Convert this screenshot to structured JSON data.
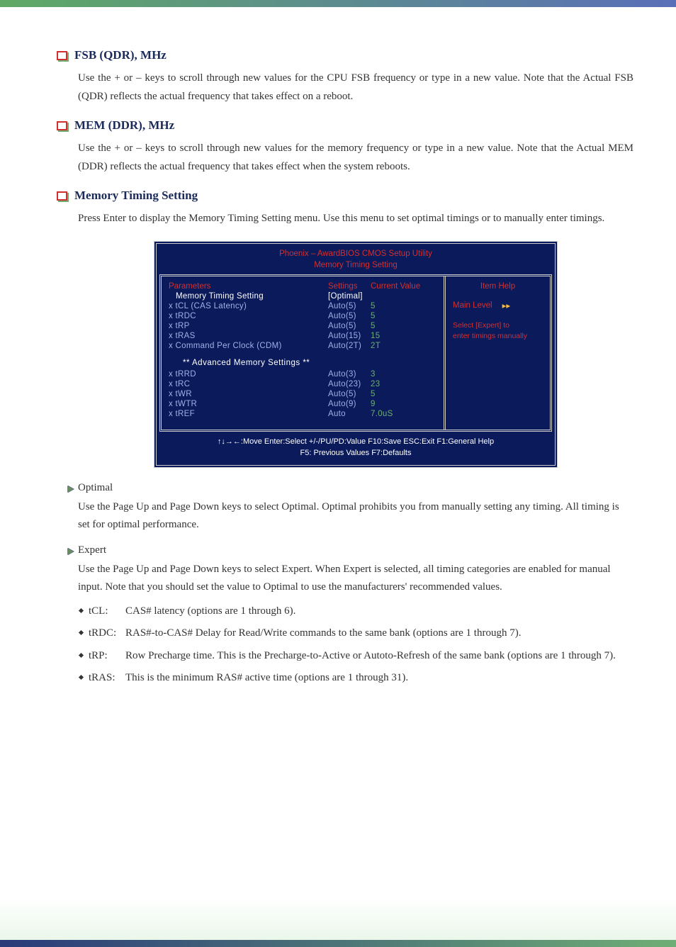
{
  "sections": {
    "fsb": {
      "title": "FSB (QDR), MHz",
      "body": "Use the + or – keys to scroll through new values for the CPU FSB frequency or type in a new value. Note that the Actual FSB (QDR) reflects the actual frequency that takes effect on a reboot."
    },
    "mem": {
      "title": "MEM (DDR), MHz",
      "body": "Use the + or – keys to scroll through new values for the memory frequency or type in a new value. Note that the Actual MEM (DDR) reflects the actual frequency that takes effect when the system reboots."
    },
    "memtiming": {
      "title": "Memory Timing Setting",
      "body": "Press Enter to display the Memory Timing Setting menu. Use this menu to set optimal timings or to manually enter timings."
    }
  },
  "bios": {
    "header1": "Phoenix – AwardBIOS CMOS Setup Utility",
    "header2": "Memory Timing Setting",
    "col_params": "Parameters",
    "col_settings": "Settings",
    "col_current": "Current Value",
    "item_help": "Item Help",
    "main_level": "Main Level",
    "help_text1": "Select [Expert] to",
    "help_text2": "enter timings manually",
    "rows": {
      "r0": {
        "p": "Memory Timing Setting",
        "s": "[Optimal]",
        "c": ""
      },
      "r1": {
        "p": "x tCL (CAS Latency)",
        "s": "Auto(5)",
        "c": "5"
      },
      "r2": {
        "p": "x tRDC",
        "s": "Auto(5)",
        "c": "5"
      },
      "r3": {
        "p": "x tRP",
        "s": "Auto(5)",
        "c": "5"
      },
      "r4": {
        "p": "x tRAS",
        "s": "Auto(15)",
        "c": "15"
      },
      "r5": {
        "p": "x Command Per Clock (CDM)",
        "s": "Auto(2T)",
        "c": "2T"
      }
    },
    "adv_header": "** Advanced Memory Settings **",
    "adv": {
      "a1": {
        "p": "x tRRD",
        "s": "Auto(3)",
        "c": "3"
      },
      "a2": {
        "p": "x tRC",
        "s": "Auto(23)",
        "c": "23"
      },
      "a3": {
        "p": "x tWR",
        "s": "Auto(5)",
        "c": "5"
      },
      "a4": {
        "p": "x tWTR",
        "s": "Auto(9)",
        "c": "9"
      },
      "a5": {
        "p": "x tREF",
        "s": "Auto",
        "c": "7.0uS"
      }
    },
    "footer1": "↑↓→←:Move   Enter:Select    +/-/PU/PD:Value    F10:Save    ESC:Exit    F1:General Help",
    "footer2": "F5: Previous Values        F7:Defaults"
  },
  "optimal": {
    "title": "Optimal",
    "body": "Use the Page Up and Page Down keys to select Optimal. Optimal prohibits you from manually setting any timing. All timing is set for optimal performance."
  },
  "expert": {
    "title": "Expert",
    "body": "Use the Page Up and Page Down keys to select Expert. When Expert is selected, all timing categories are enabled for manual input. Note that you should set the value to Optimal to use the manufacturers' recommended values."
  },
  "bullets": {
    "b1": {
      "label": "tCL:",
      "desc": "CAS# latency (options are 1 through 6)."
    },
    "b2": {
      "label": "tRDC:",
      "desc": "RAS#-to-CAS# Delay for Read/Write commands to the same bank (options are 1 through 7)."
    },
    "b3": {
      "label": "tRP:",
      "desc": "Row Precharge time. This is the Precharge-to-Active or Autoto-Refresh of the same bank (options are 1 through 7)."
    },
    "b4": {
      "label": "tRAS:",
      "desc": "This is the minimum RAS# active time (options are 1 through 31)."
    }
  }
}
